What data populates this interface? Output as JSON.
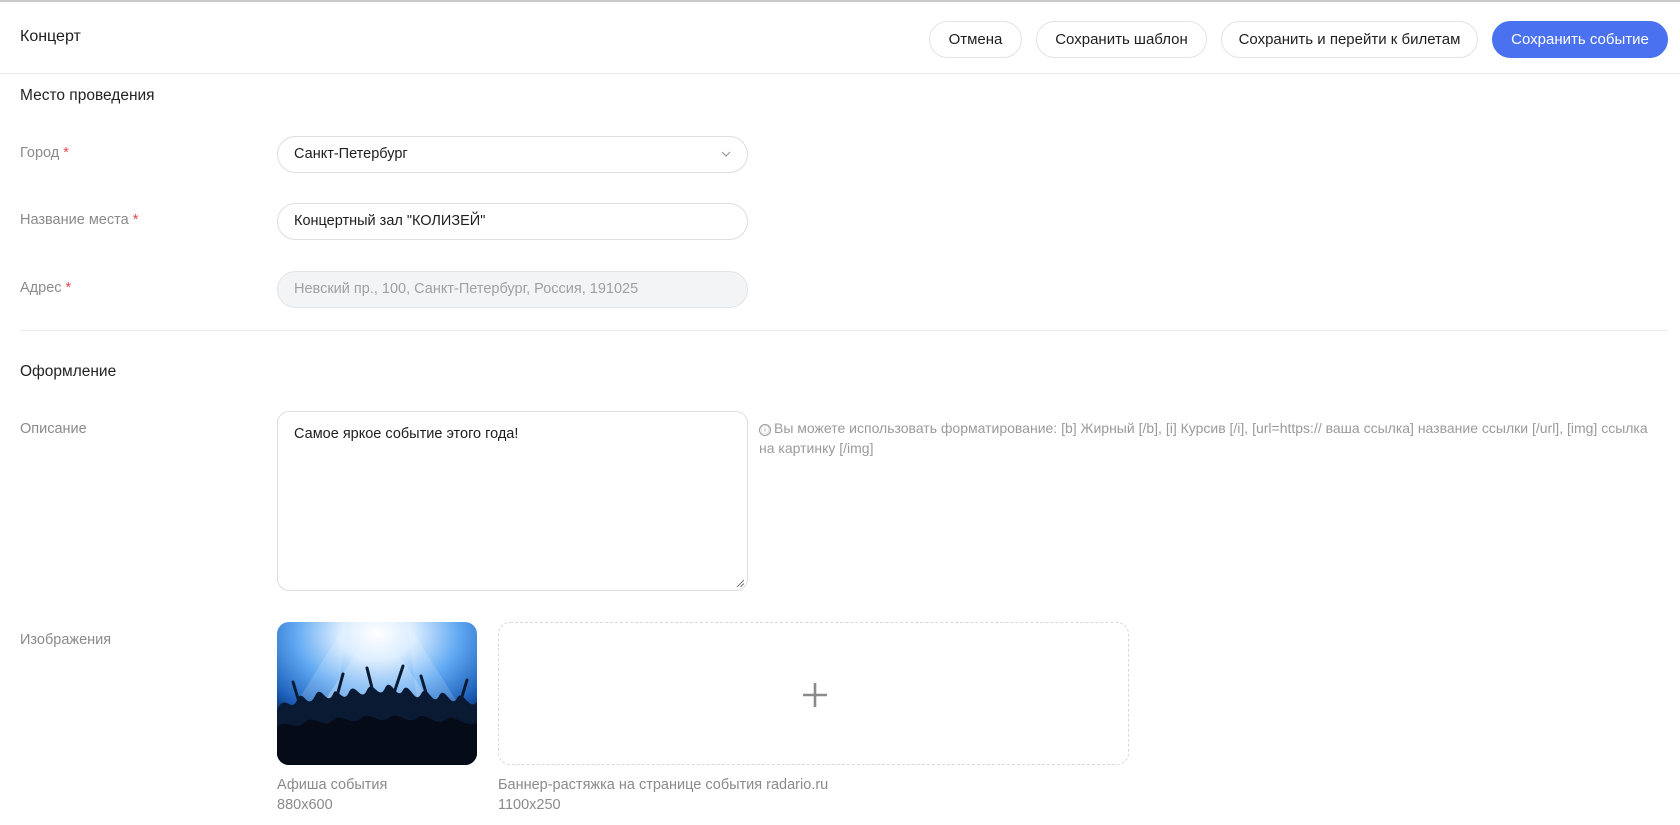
{
  "header": {
    "title": "Концерт",
    "buttons": {
      "cancel": "Отмена",
      "save_template": "Сохранить шаблон",
      "save_and_tickets": "Сохранить и перейти к билетам",
      "save_event": "Сохранить событие"
    }
  },
  "venue": {
    "section_title": "Место проведения",
    "city": {
      "label": "Город",
      "required_mark": "*",
      "value": "Санкт-Петербург"
    },
    "place": {
      "label": "Название места",
      "required_mark": "*",
      "value": "Концертный зал \"КОЛИЗЕЙ\""
    },
    "address": {
      "label": "Адрес",
      "required_mark": "*",
      "value": "Невский пр., 100, Санкт-Петербург, Россия, 191025"
    }
  },
  "design": {
    "section_title": "Оформление",
    "description": {
      "label": "Описание",
      "value": "Самое яркое событие этого года!",
      "hint_icon": "ⓘ",
      "hint": "Вы можете использовать форматирование: [b] Жирный [/b], [i] Курсив [/i], [url=https:// ваша ссылка] название ссылки [/url], [img] ссылка на картинку [/img]"
    },
    "images": {
      "label": "Изображения",
      "poster": {
        "caption": "Афиша события",
        "size": "880x600"
      },
      "banner": {
        "caption": "Баннер-растяжка на странице события radario.ru",
        "size": "1100x250"
      }
    }
  },
  "colors": {
    "primary": "#4a72f0",
    "required": "#e5484d",
    "muted_text": "#8a8a8a"
  },
  "icons": [
    "chevron-down-icon",
    "info-icon",
    "plus-icon",
    "resize-handle-icon"
  ]
}
